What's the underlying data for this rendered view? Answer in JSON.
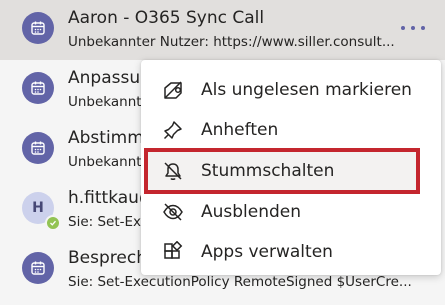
{
  "chats": [
    {
      "title": "Aaron - O365 Sync Call",
      "preview": "Unbekannter Nutzer: https://www.siller.consult...",
      "avatar_icon": "calendar-icon",
      "selected": true
    },
    {
      "title": "Anpassun",
      "preview": "Unbekannt",
      "avatar_icon": "calendar-icon"
    },
    {
      "title": "Abstimmu",
      "preview": "Unbekannt",
      "avatar_icon": "calendar-icon"
    },
    {
      "title": "h.fittkau@",
      "preview": "Sie: Set-Exe",
      "avatar_initial": "H",
      "presence": "available"
    },
    {
      "title": "Besprechu",
      "preview": "Sie: Set-ExecutionPolicy RemoteSigned $UserCre...",
      "avatar_icon": "calendar-icon"
    }
  ],
  "context_menu": {
    "items": [
      {
        "label": "Als ungelesen markieren",
        "icon": "mark-unread-icon"
      },
      {
        "label": "Anheften",
        "icon": "pin-icon"
      },
      {
        "label": "Stummschalten",
        "icon": "mute-bell-icon",
        "highlighted": true
      },
      {
        "label": "Ausblenden",
        "icon": "hide-eye-icon"
      },
      {
        "label": "Apps verwalten",
        "icon": "apps-icon"
      }
    ]
  },
  "colors": {
    "accent": "#6264a7",
    "highlight_border": "#c4262e",
    "presence_available": "#92c353",
    "selected_row": "#e1dfdd"
  }
}
